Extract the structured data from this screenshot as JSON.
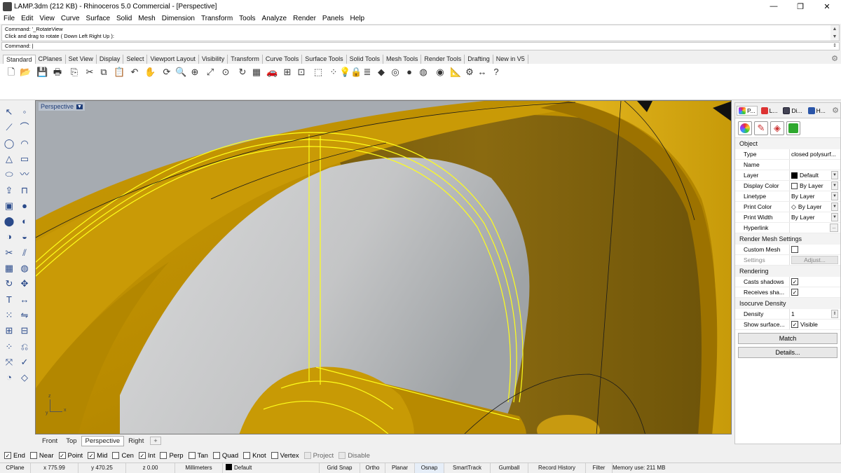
{
  "window": {
    "title": "LAMP.3dm (212 KB) - Rhinoceros 5.0 Commercial - [Perspective]",
    "minimize": "—",
    "maximize": "❐",
    "close": "✕"
  },
  "menu": [
    "File",
    "Edit",
    "View",
    "Curve",
    "Surface",
    "Solid",
    "Mesh",
    "Dimension",
    "Transform",
    "Tools",
    "Analyze",
    "Render",
    "Panels",
    "Help"
  ],
  "command": {
    "history_1": "Command: '_RotateView",
    "history_2": "Click and drag to rotate ( Down  Left  Right  Up ):",
    "prompt": "Command: |"
  },
  "toolbar_tabs": [
    "Standard",
    "CPlanes",
    "Set View",
    "Display",
    "Select",
    "Viewport Layout",
    "Visibility",
    "Transform",
    "Curve Tools",
    "Surface Tools",
    "Solid Tools",
    "Mesh Tools",
    "Render Tools",
    "Drafting",
    "New in V5"
  ],
  "toolbar_icons": [
    {
      "name": "new-icon",
      "glyph": "🗋"
    },
    {
      "name": "open-icon",
      "glyph": "📂"
    },
    {
      "name": "save-icon",
      "glyph": "💾"
    },
    {
      "name": "print-icon",
      "glyph": "🖶"
    },
    {
      "name": "import-icon",
      "glyph": "⎘"
    },
    {
      "name": "cut-icon",
      "glyph": "✂"
    },
    {
      "name": "copy-icon",
      "glyph": "⧉"
    },
    {
      "name": "paste-icon",
      "glyph": "📋"
    },
    {
      "name": "undo-icon",
      "glyph": "↶"
    },
    {
      "name": "pan-icon",
      "glyph": "✋"
    },
    {
      "name": "rotate-view-icon",
      "glyph": "⟳"
    },
    {
      "name": "zoom-icon",
      "glyph": "🔍"
    },
    {
      "name": "zoom-window-icon",
      "glyph": "⊕"
    },
    {
      "name": "zoom-extents-icon",
      "glyph": "⤢"
    },
    {
      "name": "zoom-selected-icon",
      "glyph": "⊙"
    },
    {
      "name": "rotate-icon",
      "glyph": "↻"
    },
    {
      "name": "viewport-layout-icon",
      "glyph": "▦"
    },
    {
      "name": "car-icon",
      "glyph": "🚗"
    },
    {
      "name": "cplane-icon",
      "glyph": "⊞"
    },
    {
      "name": "grid-icon",
      "glyph": "⊡"
    },
    {
      "name": "select-icon",
      "glyph": "⬚"
    },
    {
      "name": "points-icon",
      "glyph": "⁘"
    },
    {
      "name": "light-icon",
      "glyph": "💡"
    },
    {
      "name": "lock-icon",
      "glyph": "🔒"
    },
    {
      "name": "layers-icon",
      "glyph": "≣"
    },
    {
      "name": "render-icon",
      "glyph": "◆"
    },
    {
      "name": "color-wheel-icon",
      "glyph": "◎"
    },
    {
      "name": "sphere-icon",
      "glyph": "●"
    },
    {
      "name": "material-sphere-icon",
      "glyph": "◍"
    },
    {
      "name": "environment-icon",
      "glyph": "◉"
    },
    {
      "name": "analyze-icon",
      "glyph": "📐"
    },
    {
      "name": "settings-icon",
      "glyph": "⚙"
    },
    {
      "name": "dimension-icon",
      "glyph": "↔"
    },
    {
      "name": "help-icon",
      "glyph": "?"
    }
  ],
  "left_icons": [
    "select-arrow-icon",
    "point-icon",
    "polyline-icon",
    "curve-icon",
    "circle-icon",
    "arc-icon",
    "polygon-icon",
    "rectangle-icon",
    "ellipse-icon",
    "freeform-curve-icon",
    "extrude-icon",
    "surface-icon",
    "box-icon",
    "sphere-solid-icon",
    "cylinder-icon",
    "boolean-icon",
    "boolean-union-icon",
    "fillet-icon",
    "trim-icon",
    "split-icon",
    "mesh-icon",
    "mesh-sphere-icon",
    "rotate-3d-icon",
    "move-icon",
    "text-icon",
    "dimension-tool-icon",
    "array-icon",
    "mirror-icon",
    "block-icon",
    "group-icon",
    "points-grid-icon",
    "history-icon",
    "transform-icon",
    "check-icon",
    "analysis-icon",
    "sweep-icon"
  ],
  "viewport": {
    "title": "Perspective",
    "axis_z": "z",
    "axis_x": "x",
    "axis_y": "y"
  },
  "viewport_tabs": [
    "Front",
    "Top",
    "Perspective",
    "Right"
  ],
  "viewport_tab_add": "+",
  "osnap": [
    {
      "label": "End",
      "checked": true
    },
    {
      "label": "Near",
      "checked": false
    },
    {
      "label": "Point",
      "checked": true
    },
    {
      "label": "Mid",
      "checked": true
    },
    {
      "label": "Cen",
      "checked": false
    },
    {
      "label": "Int",
      "checked": true
    },
    {
      "label": "Perp",
      "checked": false
    },
    {
      "label": "Tan",
      "checked": false
    },
    {
      "label": "Quad",
      "checked": false
    },
    {
      "label": "Knot",
      "checked": false
    },
    {
      "label": "Vertex",
      "checked": false
    },
    {
      "label": "Project",
      "checked": false
    },
    {
      "label": "Disable",
      "checked": false
    }
  ],
  "status": {
    "cplane": "CPlane",
    "x": "x 775.99",
    "y": "y 470.25",
    "z": "z 0.00",
    "units": "Millimeters",
    "layer": "Default",
    "grid_snap": "Grid Snap",
    "ortho": "Ortho",
    "planar": "Planar",
    "osnap": "Osnap",
    "smarttrack": "SmartTrack",
    "gumball": "Gumball",
    "record_history": "Record History",
    "filter": "Filter",
    "memory": "Memory use: 211 MB"
  },
  "panel": {
    "tabs": [
      "P...",
      "L...",
      "Di...",
      "H..."
    ],
    "tab_icons": [
      "properties-tab-icon",
      "layers-tab-icon",
      "display-tab-icon",
      "help-tab-icon"
    ],
    "object_section": "Object",
    "props": [
      {
        "name": "Type",
        "value": "closed polysurf..."
      },
      {
        "name": "Name",
        "value": ""
      },
      {
        "name": "Layer",
        "value": "Default"
      },
      {
        "name": "Display Color",
        "value": "By Layer"
      },
      {
        "name": "Linetype",
        "value": "By Layer"
      },
      {
        "name": "Print Color",
        "value": "By Layer"
      },
      {
        "name": "Print Width",
        "value": "By Layer"
      },
      {
        "name": "Hyperlink",
        "value": ""
      }
    ],
    "hyperlink_button": "...",
    "render_mesh_section": "Render Mesh Settings",
    "custom_mesh": "Custom Mesh",
    "settings": "Settings",
    "adjust": "Adjust...",
    "rendering_section": "Rendering",
    "casts_shadows": "Casts shadows",
    "receives_shadows": "Receives sha...",
    "isocurve_section": "Isocurve Density",
    "density": "Density",
    "density_value": "1",
    "show_surface": "Show surface...",
    "visible": "Visible",
    "match": "Match",
    "details": "Details..."
  },
  "colors": {
    "gold": "#c89a00",
    "highlight": "#ffff00",
    "viewport_bg": "#a3a9b0"
  }
}
